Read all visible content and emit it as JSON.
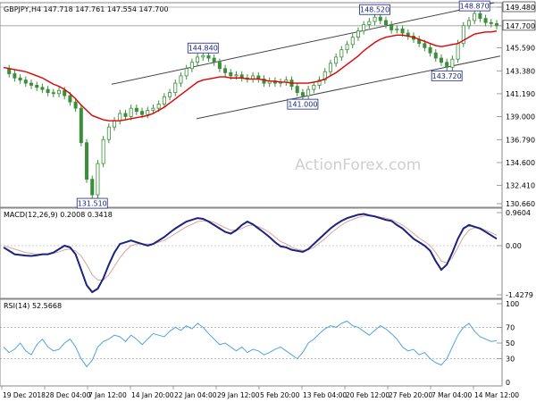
{
  "symbol_line": "GBPJPY,H4  147.718 147.761 147.554 147.700",
  "watermark": "ActionForex.com",
  "colors": {
    "candles": "#3b8e3b",
    "ma": "#e00000",
    "channel": "#444444",
    "macd": "#1a237e",
    "signal": "#d9a3a3",
    "rsi": "#4fa3e0",
    "grid": "#c8c8c8",
    "dotted": "#9a9a9a"
  },
  "time_labels": [
    "19 Dec 2018",
    "28 Dec 04:00",
    "7 Jan 12:00",
    "14 Jan 20:00",
    "22 Jan 04:00",
    "29 Jan 12:00",
    "5 Feb 20:00",
    "13 Feb 04:00",
    "20 Feb 12:00",
    "27 Feb 20:00",
    "7 Mar 04:00",
    "14 Mar 12:00"
  ],
  "chart_data": [
    {
      "type": "candlestick",
      "title": "GBPJPY,H4",
      "ohlc_last": {
        "open": 147.718,
        "high": 147.761,
        "low": 147.554,
        "close": 147.7
      },
      "y_ticks": [
        "149.480",
        "147.700",
        "145.590",
        "143.380",
        "141.190",
        "139.000",
        "136.790",
        "134.600",
        "132.410",
        "130.660"
      ],
      "ylim": [
        130.66,
        149.48
      ],
      "current_price": "147.700",
      "price_series": [
        143.6,
        143.1,
        142.7,
        142.5,
        142.2,
        142.0,
        141.8,
        141.6,
        141.3,
        141.2,
        141.5,
        141.0,
        140.4,
        139.8,
        136.5,
        133.0,
        131.51,
        134.5,
        136.8,
        138.0,
        138.6,
        139.3,
        139.0,
        139.8,
        139.5,
        139.2,
        139.6,
        139.8,
        140.2,
        140.9,
        141.3,
        142.2,
        142.9,
        143.6,
        144.2,
        144.7,
        144.84,
        144.6,
        144.2,
        143.6,
        143.2,
        142.9,
        143.0,
        142.7,
        142.6,
        142.9,
        142.6,
        142.2,
        142.4,
        142.2,
        142.3,
        142.5,
        141.9,
        141.3,
        141.0,
        141.6,
        142.0,
        142.5,
        143.3,
        144.1,
        144.7,
        145.4,
        145.9,
        146.6,
        147.2,
        147.8,
        148.1,
        148.52,
        148.2,
        147.8,
        147.3,
        147.4,
        147.0,
        146.7,
        146.4,
        146.0,
        145.6,
        145.1,
        144.6,
        144.2,
        143.72,
        144.5,
        146.0,
        147.7,
        148.2,
        148.87,
        148.4,
        148.0,
        147.9,
        147.7
      ],
      "ma_series": [
        143.7,
        143.6,
        143.5,
        143.4,
        143.3,
        143.1,
        142.9,
        142.7,
        142.4,
        142.1,
        141.9,
        141.6,
        141.2,
        140.7,
        140.1,
        139.6,
        139.1,
        138.9,
        138.7,
        138.6,
        138.6,
        138.6,
        138.7,
        138.8,
        138.9,
        139.0,
        139.1,
        139.3,
        139.6,
        139.9,
        140.3,
        140.7,
        141.1,
        141.5,
        141.9,
        142.3,
        142.5,
        142.6,
        142.7,
        142.8,
        142.8,
        142.7,
        142.7,
        142.7,
        142.6,
        142.6,
        142.6,
        142.5,
        142.4,
        142.4,
        142.3,
        142.3,
        142.2,
        142.2,
        142.2,
        142.2,
        142.3,
        142.4,
        142.6,
        142.9,
        143.2,
        143.6,
        144.0,
        144.4,
        144.8,
        145.3,
        145.7,
        146.1,
        146.4,
        146.6,
        146.7,
        146.8,
        146.8,
        146.7,
        146.6,
        146.4,
        146.2,
        146.0,
        145.8,
        145.7,
        145.8,
        145.9,
        146.0,
        146.3,
        146.6,
        146.9,
        147.0,
        147.1,
        147.1,
        147.2
      ],
      "channel_upper": [
        [
          130.0,
          142.1
        ],
        [
          148.9,
          149.9
        ]
      ],
      "channel_lower": [
        [
          139.9,
          138.8
        ],
        [
          153.1,
          144.8
        ]
      ],
      "annotations": [
        {
          "label": "131.510",
          "value": 131.51,
          "index": 16
        },
        {
          "label": "144.840",
          "value": 144.84,
          "index": 36
        },
        {
          "label": "141.000",
          "value": 141.0,
          "index": 54
        },
        {
          "label": "148.520",
          "value": 148.52,
          "index": 67
        },
        {
          "label": "143.720",
          "value": 143.72,
          "index": 80
        },
        {
          "label": "148.870",
          "value": 148.87,
          "index": 85
        }
      ]
    },
    {
      "type": "line",
      "title": "MACD(12,26,9) 0.2008 0.3418",
      "y_ticks": [
        "0.9604",
        "0.00",
        "-1.4279"
      ],
      "ylim": [
        -1.4279,
        0.9604
      ],
      "series": [
        {
          "name": "MACD",
          "values": [
            -0.05,
            -0.15,
            -0.25,
            -0.27,
            -0.29,
            -0.3,
            -0.28,
            -0.25,
            -0.25,
            -0.2,
            -0.1,
            0.0,
            -0.05,
            -0.25,
            -0.7,
            -1.15,
            -1.35,
            -1.25,
            -0.95,
            -0.55,
            -0.2,
            0.05,
            0.1,
            0.15,
            0.1,
            0.05,
            0.0,
            0.05,
            0.15,
            0.25,
            0.38,
            0.5,
            0.6,
            0.7,
            0.75,
            0.8,
            0.78,
            0.7,
            0.6,
            0.5,
            0.4,
            0.35,
            0.45,
            0.6,
            0.7,
            0.62,
            0.5,
            0.38,
            0.25,
            0.1,
            -0.02,
            -0.05,
            -0.12,
            -0.15,
            -0.18,
            -0.1,
            0.05,
            0.2,
            0.35,
            0.5,
            0.62,
            0.72,
            0.8,
            0.85,
            0.9,
            0.92,
            0.88,
            0.85,
            0.8,
            0.75,
            0.72,
            0.6,
            0.5,
            0.35,
            0.2,
            0.1,
            0.0,
            -0.15,
            -0.45,
            -0.7,
            -0.55,
            -0.2,
            0.2,
            0.5,
            0.6,
            0.55,
            0.5,
            0.4,
            0.3,
            0.2
          ]
        },
        {
          "name": "Signal",
          "values": [
            0.0,
            -0.05,
            -0.1,
            -0.15,
            -0.2,
            -0.22,
            -0.25,
            -0.25,
            -0.25,
            -0.22,
            -0.18,
            -0.12,
            -0.1,
            -0.15,
            -0.3,
            -0.55,
            -0.85,
            -1.0,
            -1.0,
            -0.85,
            -0.6,
            -0.35,
            -0.15,
            0.0,
            0.05,
            0.05,
            0.05,
            0.05,
            0.1,
            0.15,
            0.25,
            0.35,
            0.45,
            0.55,
            0.62,
            0.7,
            0.72,
            0.72,
            0.68,
            0.6,
            0.52,
            0.45,
            0.45,
            0.5,
            0.58,
            0.6,
            0.55,
            0.48,
            0.38,
            0.25,
            0.12,
            0.05,
            -0.05,
            -0.1,
            -0.14,
            -0.12,
            -0.05,
            0.08,
            0.2,
            0.35,
            0.48,
            0.6,
            0.7,
            0.76,
            0.82,
            0.86,
            0.87,
            0.86,
            0.83,
            0.8,
            0.76,
            0.68,
            0.6,
            0.48,
            0.35,
            0.22,
            0.12,
            0.0,
            -0.2,
            -0.45,
            -0.5,
            -0.35,
            -0.05,
            0.25,
            0.45,
            0.52,
            0.52,
            0.45,
            0.38,
            0.3
          ]
        }
      ]
    },
    {
      "type": "line",
      "title": "RSI(14) 52.5668",
      "y_ticks": [
        "100",
        "70",
        "50",
        "30",
        "0"
      ],
      "ylim": [
        0,
        100
      ],
      "series": [
        {
          "name": "RSI",
          "values": [
            45,
            38,
            42,
            50,
            40,
            35,
            48,
            55,
            45,
            40,
            42,
            50,
            55,
            45,
            30,
            20,
            28,
            45,
            52,
            55,
            60,
            58,
            52,
            60,
            55,
            48,
            55,
            62,
            60,
            58,
            65,
            70,
            66,
            72,
            68,
            75,
            70,
            62,
            55,
            48,
            50,
            45,
            40,
            45,
            38,
            42,
            40,
            35,
            38,
            42,
            45,
            40,
            35,
            30,
            38,
            50,
            55,
            62,
            68,
            72,
            70,
            75,
            78,
            72,
            70,
            65,
            60,
            66,
            72,
            68,
            62,
            55,
            45,
            40,
            42,
            35,
            38,
            30,
            25,
            22,
            30,
            45,
            60,
            70,
            75,
            65,
            58,
            55,
            52,
            53
          ]
        }
      ]
    }
  ]
}
